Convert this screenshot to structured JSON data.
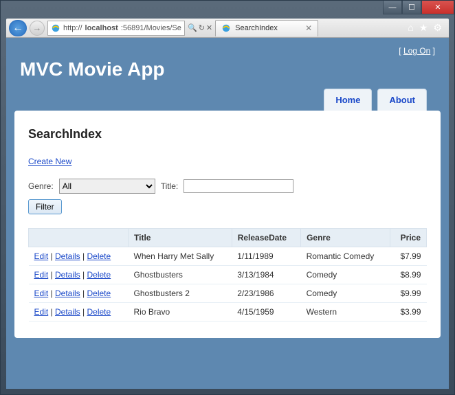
{
  "window": {
    "min_icon": "—",
    "max_icon": "☐",
    "close_icon": "✕"
  },
  "browser": {
    "back_icon": "←",
    "fwd_icon": "→",
    "url": "http://localhost:56891/Movies/Se",
    "url_prefix": "http://",
    "url_host": "localhost",
    "url_rest": ":56891/Movies/Se",
    "search_icon": "🔍",
    "refresh_icon": "↻",
    "stop_icon": "✕",
    "tab_title": "SearchIndex",
    "tab_close": "✕",
    "home_icon": "⌂",
    "fav_icon": "★",
    "gear_icon": "⚙"
  },
  "page": {
    "logon_left": "[ ",
    "logon_link": "Log On",
    "logon_right": " ]",
    "app_title": "MVC Movie App",
    "nav": {
      "home": "Home",
      "about": "About"
    },
    "heading": "SearchIndex",
    "create_link": "Create New",
    "genre_label": "Genre:",
    "genre_selected": "All",
    "title_label": "Title:",
    "title_value": "",
    "filter_button": "Filter",
    "columns": {
      "actions": "",
      "title": "Title",
      "release": "ReleaseDate",
      "genre": "Genre",
      "price": "Price"
    },
    "action_labels": {
      "edit": "Edit",
      "details": "Details",
      "delete": "Delete"
    },
    "rows": [
      {
        "title": "When Harry Met Sally",
        "release": "1/11/1989",
        "genre": "Romantic Comedy",
        "price": "$7.99"
      },
      {
        "title": "Ghostbusters",
        "release": "3/13/1984",
        "genre": "Comedy",
        "price": "$8.99"
      },
      {
        "title": "Ghostbusters 2",
        "release": "2/23/1986",
        "genre": "Comedy",
        "price": "$9.99"
      },
      {
        "title": "Rio Bravo",
        "release": "4/15/1959",
        "genre": "Western",
        "price": "$3.99"
      }
    ]
  }
}
